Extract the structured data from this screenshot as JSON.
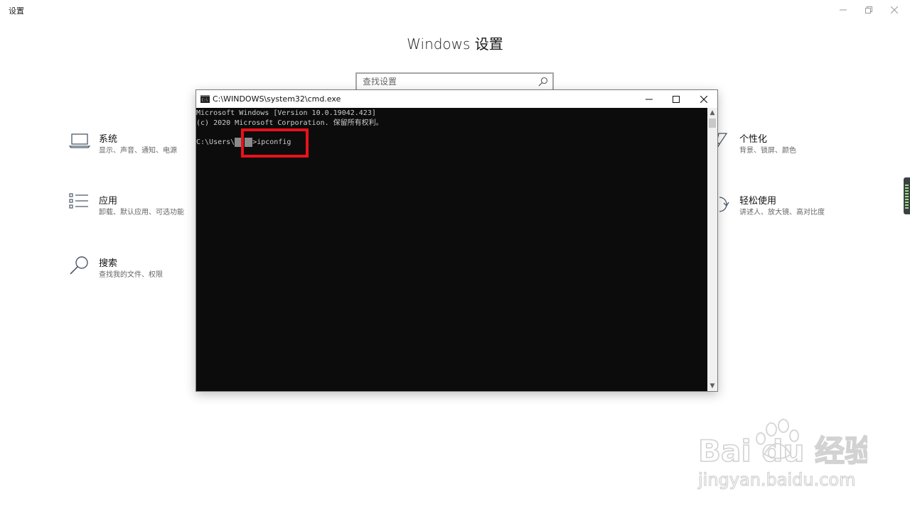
{
  "app": {
    "title": "设置",
    "heading": "Windows 设置"
  },
  "search": {
    "placeholder": "查找设置"
  },
  "tiles": [
    {
      "name": "系统",
      "desc": "显示、声音、通知、电源",
      "icon": "laptop-icon"
    },
    {
      "name": "应用",
      "desc": "卸载、默认应用、可选功能",
      "icon": "apps-list-icon"
    },
    {
      "name": "搜索",
      "desc": "查找我的文件、权限",
      "icon": "search-icon"
    },
    {
      "name": "个性化",
      "desc": "背景、锁屏、颜色",
      "icon": "brush-icon"
    },
    {
      "name": "轻松使用",
      "desc": "讲述人、放大镜、高对比度",
      "icon": "ease-of-access-icon"
    }
  ],
  "cmd": {
    "title": "C:\\WINDOWS\\system32\\cmd.exe",
    "lines": {
      "l1": "Microsoft Windows [Version 10.0.19042.423]",
      "l2": "(c) 2020 Microsoft Corporation. 保留所有权利。",
      "prompt_prefix": "C:\\Users\\",
      "prompt_suffix": ">ipconfig"
    }
  },
  "watermark": {
    "brand": "Bai du 经验",
    "url": "jingyan.baidu.com"
  },
  "colors": {
    "highlight": "#e8121a",
    "console_bg": "#0c0c0c",
    "console_fg": "#cccccc"
  }
}
